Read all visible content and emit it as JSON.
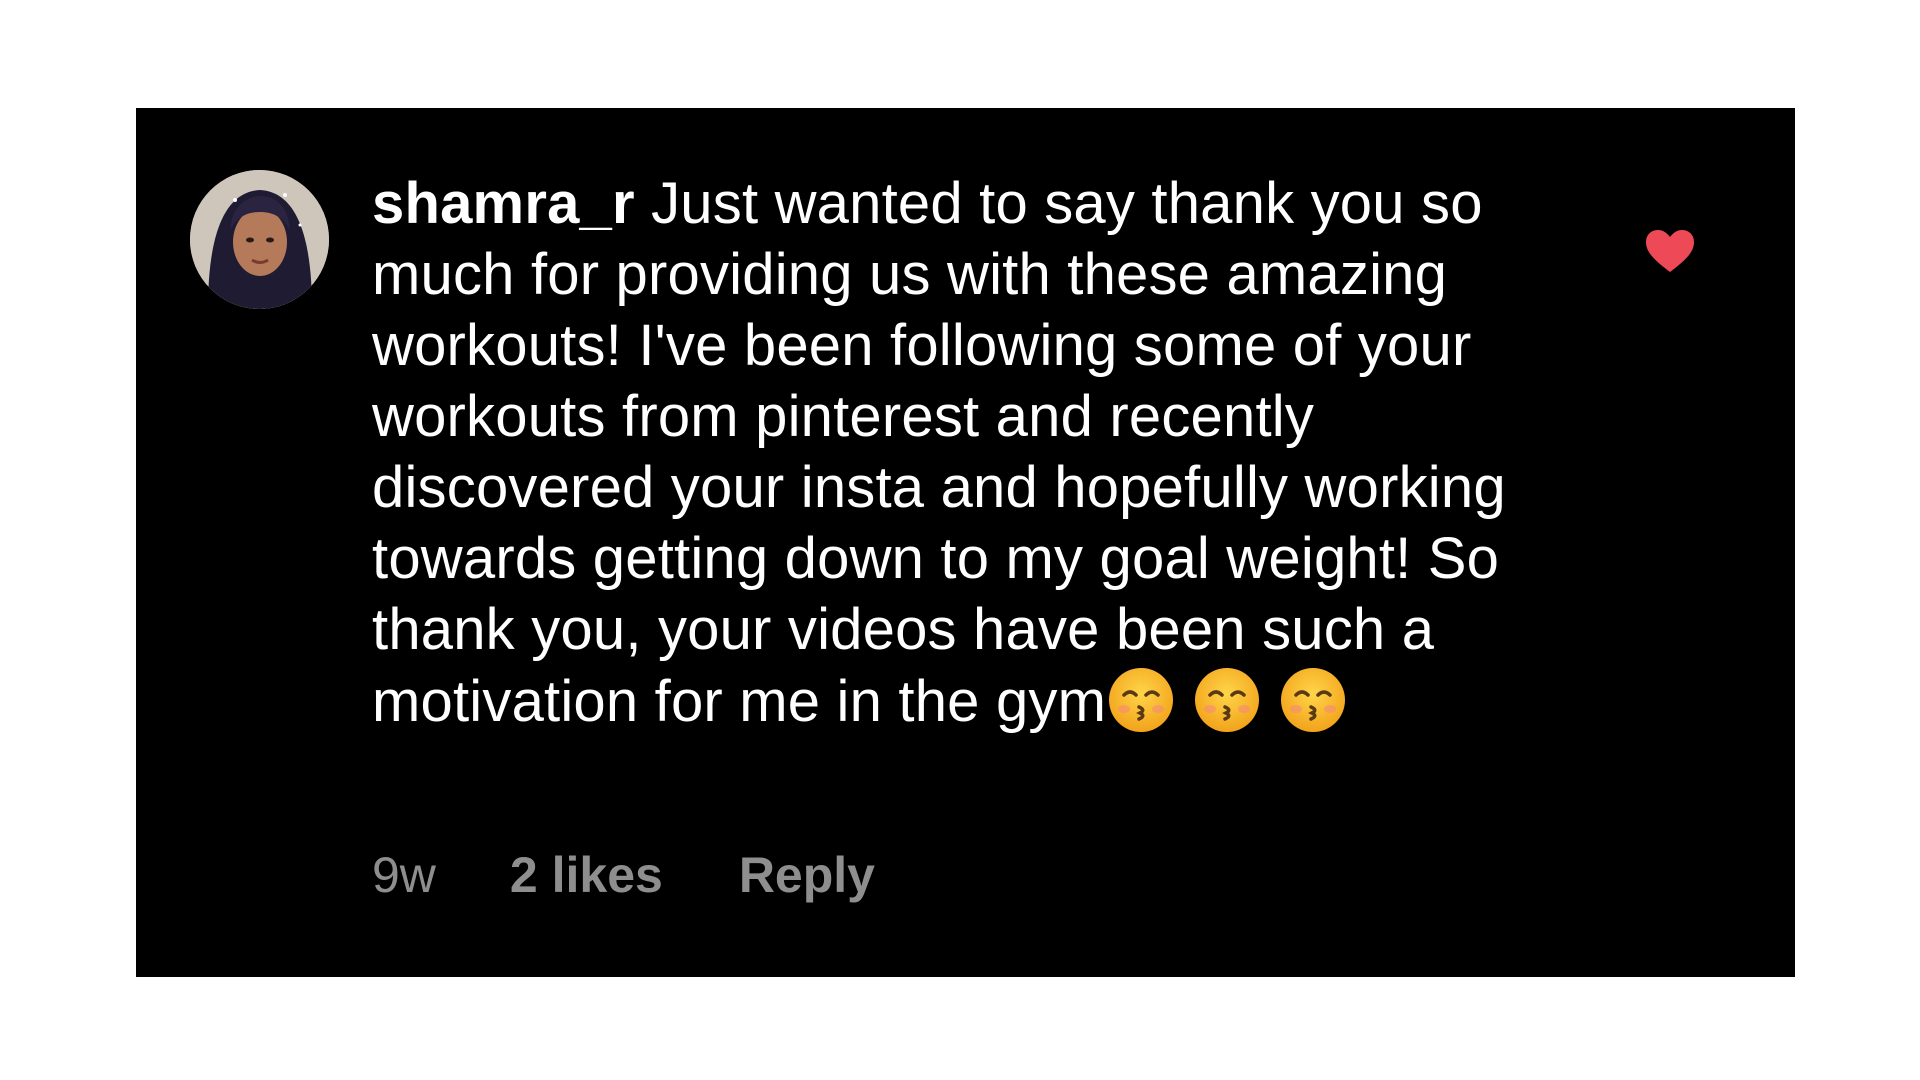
{
  "comment": {
    "username": "shamra_r",
    "text": "Just wanted to say thank you so much for providing  us with these amazing workouts! I've been following some of your workouts from pinterest and recently discovered your insta and hopefully working towards getting down to my goal weight! So thank you, your videos have been such a motivation for me in the gym",
    "emojis": [
      "kissing-face-with-smiling-eyes-icon",
      "kissing-face-with-smiling-eyes-icon",
      "kissing-face-with-smiling-eyes-icon"
    ],
    "liked": true
  },
  "meta": {
    "time": "9w",
    "likes": "2 likes",
    "reply": "Reply"
  },
  "colors": {
    "background": "#000000",
    "text": "#ffffff",
    "meta": "#8e8e8e",
    "heart": "#ed4956"
  }
}
